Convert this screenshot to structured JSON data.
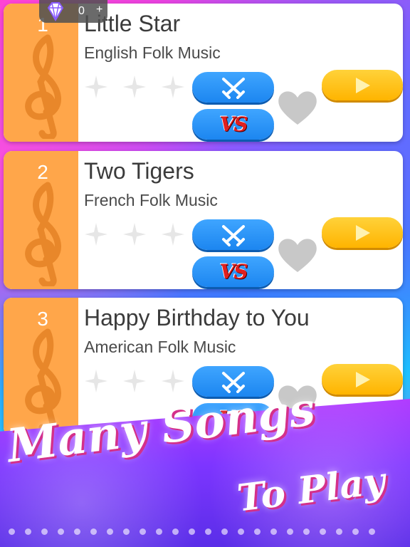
{
  "currency": {
    "count": "0",
    "plus_label": "+"
  },
  "songs": [
    {
      "number": "1",
      "title": "Little Star",
      "subtitle": "English Folk Music"
    },
    {
      "number": "2",
      "title": "Two Tigers",
      "subtitle": "French Folk Music"
    },
    {
      "number": "3",
      "title": "Happy Birthday to You",
      "subtitle": "American Folk Music"
    }
  ],
  "buttons": {
    "vs_label": "VS"
  },
  "banner": {
    "line1": "Many Songs",
    "line2": "To Play"
  },
  "colors": {
    "accent_orange": "#ffa64a",
    "battle_blue": "#1c86f0",
    "play_yellow": "#ffb400"
  },
  "icons": {
    "gem": "diamond-icon",
    "clef": "treble-clef-icon",
    "star": "star-icon",
    "battle": "crossed-swords-icon",
    "play": "play-icon",
    "heart": "heart-icon"
  }
}
